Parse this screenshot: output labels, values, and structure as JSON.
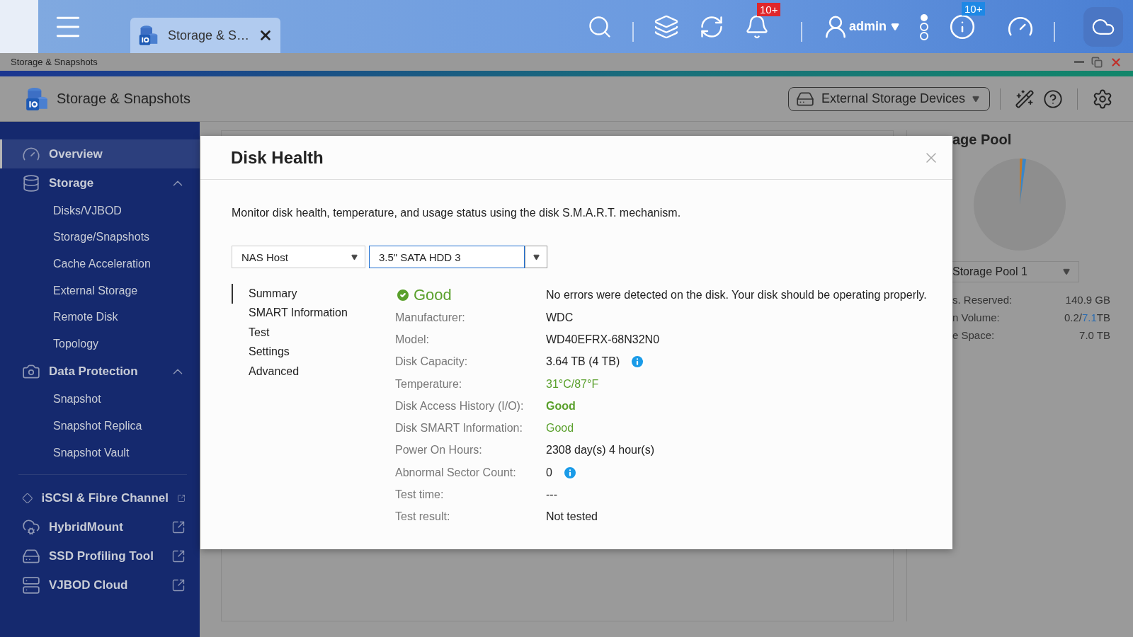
{
  "top_bar": {
    "tab": {
      "label": "Storage & S…"
    },
    "notification_badge": "10+",
    "user": {
      "name": "admin"
    },
    "info_badge": "10+"
  },
  "window": {
    "title": "Storage & Snapshots"
  },
  "app_header": {
    "title": "Storage & Snapshots",
    "device_select": "External Storage Devices"
  },
  "sidebar": {
    "items": [
      {
        "label": "Overview",
        "kind": "link",
        "selected": true
      },
      {
        "label": "Storage",
        "kind": "group",
        "selected": false,
        "expanded": true,
        "children": [
          {
            "label": "Disks/VJBOD",
            "selected": false
          },
          {
            "label": "Storage/Snapshots",
            "selected": false
          },
          {
            "label": "Cache Acceleration",
            "selected": false
          },
          {
            "label": "External Storage",
            "selected": false
          },
          {
            "label": "Remote Disk",
            "selected": false
          },
          {
            "label": "Topology",
            "selected": false
          }
        ]
      },
      {
        "label": "Data Protection",
        "kind": "group",
        "selected": false,
        "expanded": true,
        "children": [
          {
            "label": "Snapshot",
            "selected": false
          },
          {
            "label": "Snapshot Replica",
            "selected": false
          },
          {
            "label": "Snapshot Vault",
            "selected": false
          }
        ]
      },
      {
        "label": "iSCSI & Fibre Channel",
        "kind": "external",
        "selected": false
      },
      {
        "label": "HybridMount",
        "kind": "external",
        "selected": false
      },
      {
        "label": "SSD Profiling Tool",
        "kind": "external",
        "selected": false
      },
      {
        "label": "VJBOD Cloud",
        "kind": "external",
        "selected": false
      }
    ]
  },
  "right_panel": {
    "title": "age Pool",
    "pool_select": "Storage Pool 1",
    "stats": [
      {
        "label": "s. Reserved:",
        "value": "140.9 GB"
      },
      {
        "label": "n Volume:",
        "value": "0.2/",
        "value_highlight": "7.1",
        "value_suffix": "TB"
      },
      {
        "label": "e Space:",
        "value": "7.0 TB"
      }
    ]
  },
  "dialog": {
    "title": "Disk Health",
    "description": "Monitor disk health, temperature, and usage status using the disk S.M.A.R.T. mechanism.",
    "host_select": "NAS Host",
    "disk_select": "3.5\" SATA HDD 3",
    "nav": [
      {
        "label": "Summary",
        "selected": true
      },
      {
        "label": "SMART Information",
        "selected": false
      },
      {
        "label": "Test",
        "selected": false
      },
      {
        "label": "Settings",
        "selected": false
      },
      {
        "label": "Advanced",
        "selected": false
      }
    ],
    "status": {
      "label": "Good",
      "message": "No errors were detected on the disk. Your disk should be operating properly."
    },
    "rows": [
      {
        "label": "Manufacturer:",
        "value": "WDC",
        "kind": "text",
        "has_info": false
      },
      {
        "label": "Model:",
        "value": "WD40EFRX-68N32N0",
        "kind": "text",
        "has_info": false
      },
      {
        "label": "Disk Capacity:",
        "value": "3.64 TB (4 TB)",
        "kind": "text",
        "has_info": true
      },
      {
        "label": "Temperature:",
        "value": "31°C/87°F",
        "kind": "status",
        "has_info": false
      },
      {
        "label": "Disk Access History (I/O):",
        "value": "Good",
        "kind": "status_bold",
        "has_info": false
      },
      {
        "label": "Disk SMART Information:",
        "value": "Good",
        "kind": "status",
        "has_info": false
      },
      {
        "label": "Power On Hours:",
        "value": "2308 day(s) 4 hour(s)",
        "kind": "text",
        "has_info": false
      },
      {
        "label": "Abnormal Sector Count:",
        "value": "0",
        "kind": "text",
        "has_info": true
      },
      {
        "label": "Test time:",
        "value": "---",
        "kind": "text",
        "has_info": false
      },
      {
        "label": "Test result:",
        "value": "Not tested",
        "kind": "text",
        "has_info": false
      }
    ]
  }
}
